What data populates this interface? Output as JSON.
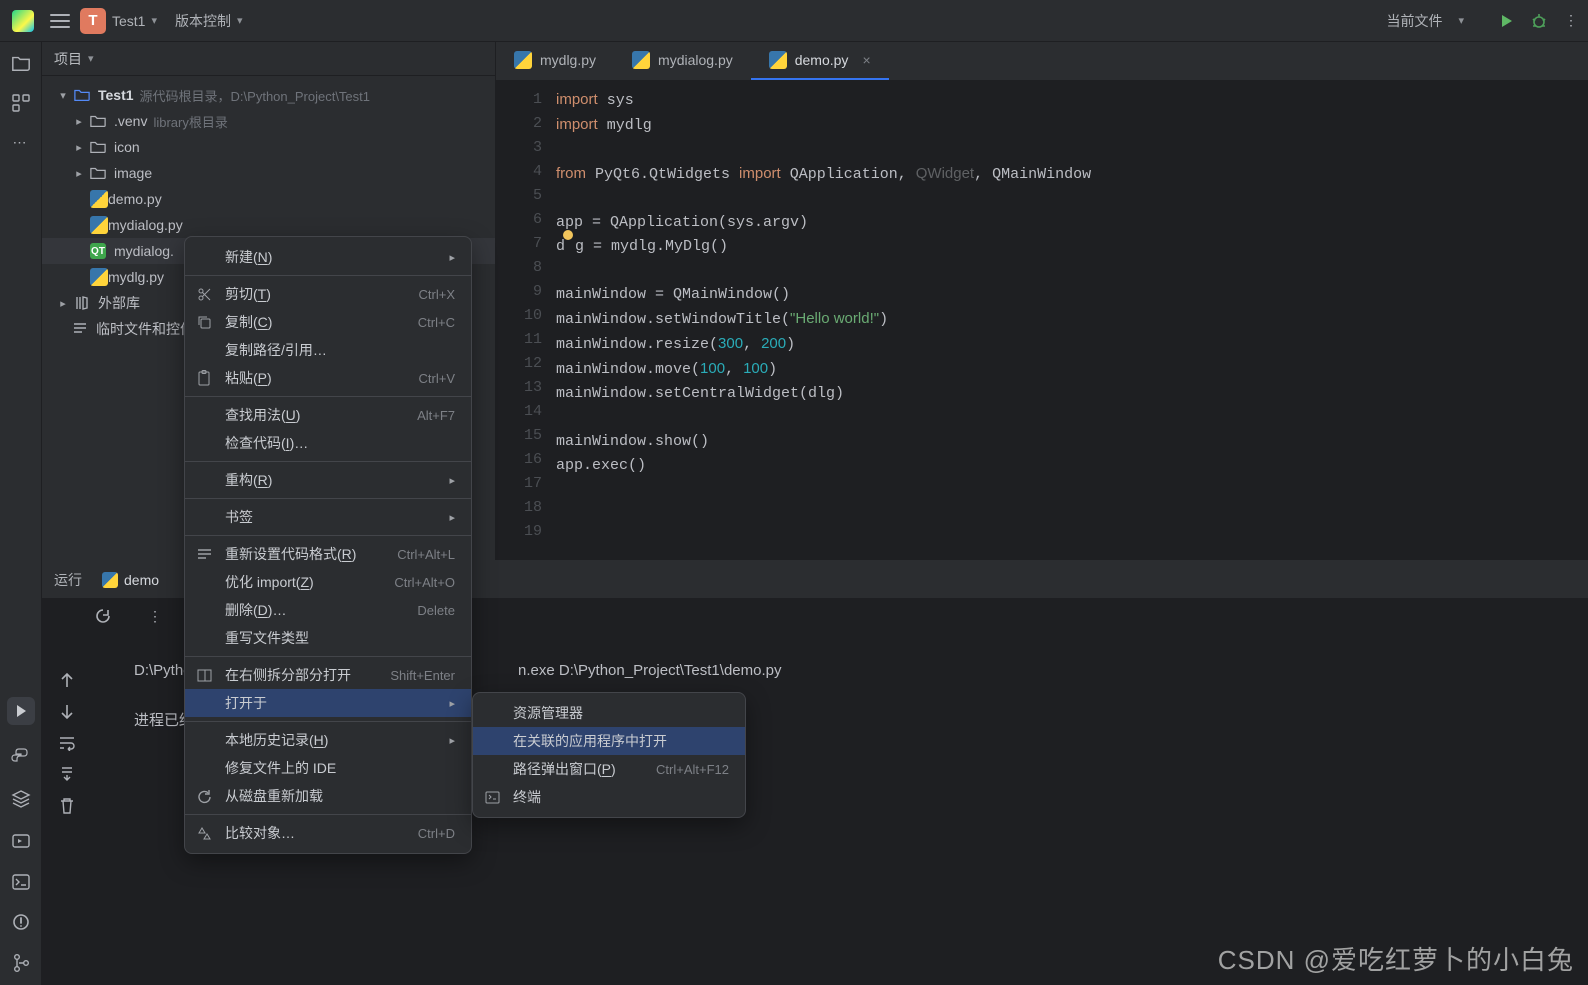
{
  "topbar": {
    "project_badge": "T",
    "project_name": "Test1",
    "version_control": "版本控制",
    "current_file": "当前文件"
  },
  "project_panel": {
    "title": "项目",
    "root": {
      "name": "Test1",
      "hint": "源代码根目录，D:\\Python_Project\\Test1"
    },
    "items": [
      {
        "name": ".venv",
        "hint": "library根目录",
        "kind": "folder"
      },
      {
        "name": "icon",
        "kind": "folder"
      },
      {
        "name": "image",
        "kind": "folder"
      },
      {
        "name": "demo.py",
        "kind": "py"
      },
      {
        "name": "mydialog.py",
        "kind": "py"
      },
      {
        "name": "mydialog.",
        "kind": "qt"
      },
      {
        "name": "mydlg.py",
        "kind": "py"
      }
    ],
    "ext_lib": "外部库",
    "scratch": "临时文件和控件"
  },
  "tabs": [
    {
      "label": "mydlg.py"
    },
    {
      "label": "mydialog.py"
    },
    {
      "label": "demo.py"
    }
  ],
  "run_panel": {
    "tab_run": "运行",
    "tab_file": "demo",
    "console_line": "n.exe D:\\Python_Project\\Test1\\demo.py",
    "finished": "进程已结束，"
  },
  "context_menu": {
    "new": "新建(N)",
    "cut": "剪切(T)",
    "cut_sc": "Ctrl+X",
    "copy": "复制(C)",
    "copy_sc": "Ctrl+C",
    "copy_path": "复制路径/引用…",
    "paste": "粘贴(P)",
    "paste_sc": "Ctrl+V",
    "find_usage": "查找用法(U)",
    "find_sc": "Alt+F7",
    "inspect": "检查代码(I)…",
    "refactor": "重构(R)",
    "bookmark": "书签",
    "reformat": "重新设置代码格式(R)",
    "reformat_sc": "Ctrl+Alt+L",
    "optimize": "优化 import(Z)",
    "optimize_sc": "Ctrl+Alt+O",
    "delete": "删除(D)…",
    "delete_sc": "Delete",
    "override": "重写文件类型",
    "open_split": "在右侧拆分部分打开",
    "open_split_sc": "Shift+Enter",
    "open_in": "打开于",
    "local_hist": "本地历史记录(H)",
    "repair": "修复文件上的 IDE",
    "reload": "从磁盘重新加载",
    "compare": "比较对象…",
    "compare_sc": "Ctrl+D"
  },
  "submenu": {
    "explorer": "资源管理器",
    "assoc_app": "在关联的应用程序中打开",
    "path_popup": "路径弹出窗口(P)",
    "path_sc": "Ctrl+Alt+F12",
    "terminal": "终端"
  },
  "code": {
    "lines": [
      "import sys",
      "import mydlg",
      "",
      "from PyQt6.QtWidgets import QApplication, QWidget, QMainWindow",
      "",
      "app = QApplication(sys.argv)",
      "dlg = mydlg.MyDlg()",
      "",
      "mainWindow = QMainWindow()",
      "mainWindow.setWindowTitle(\"Hello world!\")",
      "mainWindow.resize(300, 200)",
      "mainWindow.move(100, 100)",
      "mainWindow.setCentralWidget(dlg)",
      "",
      "mainWindow.show()",
      "app.exec()",
      "",
      "",
      ""
    ]
  },
  "watermark": "CSDN @爱吃红萝卜的小白兔",
  "console_prefix": "D:\\Python_"
}
